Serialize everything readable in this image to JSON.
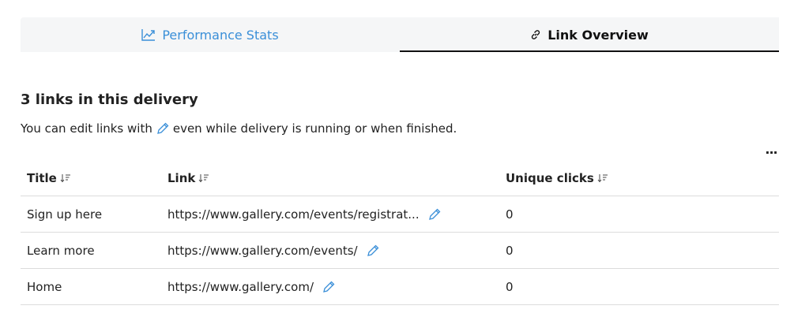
{
  "tabs": [
    {
      "label": "Performance Stats",
      "icon": "chart-line-icon",
      "active": false
    },
    {
      "label": "Link Overview",
      "icon": "link-icon",
      "active": true
    }
  ],
  "heading": "3 links in this delivery",
  "subtitle": {
    "before": "You can edit links with",
    "after": "even while delivery is running or when finished."
  },
  "more_label": "...",
  "table": {
    "columns": [
      "Title",
      "Link",
      "Unique clicks"
    ],
    "rows": [
      {
        "title": "Sign up here",
        "link": "https://www.gallery.com/events/registrat...",
        "clicks": "0"
      },
      {
        "title": "Learn more",
        "link": "https://www.gallery.com/events/",
        "clicks": "0"
      },
      {
        "title": "Home",
        "link": "https://www.gallery.com/",
        "clicks": "0"
      }
    ]
  },
  "colors": {
    "accent": "#3a8fd8",
    "tab_bg": "#f5f6f7",
    "divider": "#dcdcdc"
  }
}
